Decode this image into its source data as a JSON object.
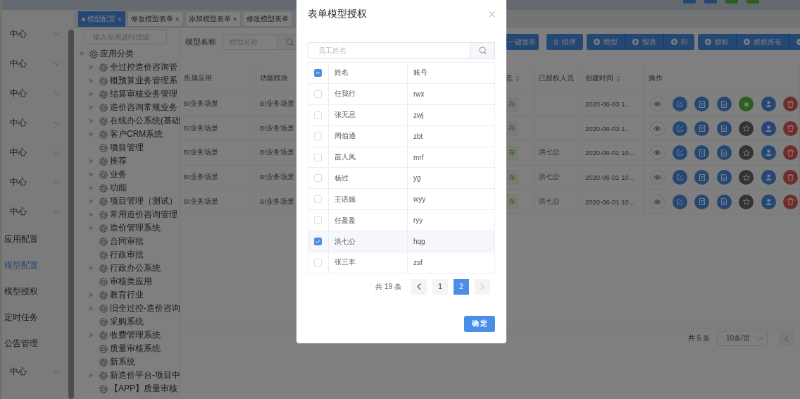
{
  "sidebar": {
    "groups": [
      {
        "label": "中心",
        "expanded": false
      },
      {
        "label": "中心",
        "expanded": false
      },
      {
        "label": "中心",
        "expanded": false
      },
      {
        "label": "中心",
        "expanded": false
      },
      {
        "label": "中心",
        "expanded": false
      },
      {
        "label": "中心",
        "expanded": false
      },
      {
        "label": "中心",
        "expanded": true,
        "children": [
          {
            "label": "应用配置",
            "selected": false
          },
          {
            "label": "模型配置",
            "selected": true
          },
          {
            "label": "模型授权",
            "selected": false
          },
          {
            "label": "定时任务",
            "selected": false
          },
          {
            "label": "公告管理",
            "selected": false
          }
        ]
      },
      {
        "label": "中心",
        "expanded": false
      }
    ]
  },
  "tabs": [
    {
      "label": "模型配置",
      "selected": true,
      "close": "×"
    },
    {
      "label": "修改模型表单",
      "selected": false,
      "close": "×"
    },
    {
      "label": "添加模型表单",
      "selected": false,
      "close": "×"
    },
    {
      "label": "修改模型表单",
      "selected": false
    }
  ],
  "tree": {
    "filter_placeholder": "输入应用进行过滤",
    "root": {
      "label": "应用分类",
      "kind": "branch",
      "expanded": true,
      "children": [
        {
          "label": "全过控造价咨询管",
          "kind": "branch"
        },
        {
          "label": "概预算业务管理系",
          "kind": "branch"
        },
        {
          "label": "结算审核业务管理",
          "kind": "branch"
        },
        {
          "label": "造价咨询常规业务",
          "kind": "branch"
        },
        {
          "label": "在线办公系统(基础",
          "kind": "branch"
        },
        {
          "label": "客户CRM系统",
          "kind": "branch"
        },
        {
          "label": "项目管理",
          "kind": "leaf"
        },
        {
          "label": "推荐",
          "kind": "branch"
        },
        {
          "label": "业务",
          "kind": "branch"
        },
        {
          "label": "功能",
          "kind": "branch"
        },
        {
          "label": "项目管理（测试）",
          "kind": "branch"
        },
        {
          "label": "常用造价咨询管理",
          "kind": "branch"
        },
        {
          "label": "造价管理系统",
          "kind": "branch"
        },
        {
          "label": "合同审批",
          "kind": "leaf"
        },
        {
          "label": "行政审批",
          "kind": "leaf"
        },
        {
          "label": "行政办公系统",
          "kind": "branch"
        },
        {
          "label": "审核类应用",
          "kind": "leaf"
        },
        {
          "label": "教育行业",
          "kind": "branch"
        },
        {
          "label": "旧全过控-造价咨询",
          "kind": "branch"
        },
        {
          "label": "采购系统",
          "kind": "leaf"
        },
        {
          "label": "收费管理系统",
          "kind": "branch"
        },
        {
          "label": "质量审核系统",
          "kind": "leaf"
        },
        {
          "label": "新系统",
          "kind": "leaf"
        },
        {
          "label": "新造价平台-项目中",
          "kind": "branch"
        },
        {
          "label": "【APP】质量审核",
          "kind": "leaf"
        }
      ]
    }
  },
  "toolbar": {
    "label": "模型名称",
    "search_placeholder": "模型名称",
    "button_groups": [
      [
        {
          "label": "一键发布",
          "kind": "plain"
        }
      ],
      [
        {
          "label": "排序",
          "kind": "sort"
        }
      ],
      [
        {
          "label": "模型",
          "kind": "add"
        },
        {
          "label": "报表",
          "kind": "add"
        },
        {
          "label": "BI",
          "kind": "add"
        }
      ],
      [
        {
          "label": "授权",
          "kind": "add"
        },
        {
          "label": "授权所有",
          "kind": "add"
        },
        {
          "kind": "remove"
        }
      ]
    ]
  },
  "table": {
    "columns": [
      {
        "label": "所属应用",
        "sortable": false
      },
      {
        "label": "功能模块",
        "sortable": false
      },
      {
        "label": "态",
        "sortable": true
      },
      {
        "label": "已授权人员",
        "sortable": false
      },
      {
        "label": "创建时间",
        "sortable": true
      },
      {
        "label": "操作",
        "sortable": false
      }
    ],
    "rows": [
      {
        "app": "BI业务场景",
        "module": "BI业务场景",
        "status": "布",
        "published": false,
        "created": "2020-06-03 1...",
        "starred": true
      },
      {
        "app": "BI业务场景",
        "module": "BI业务场景",
        "status": "布",
        "published": true,
        "created": "2020-06-03 1...",
        "starred": false
      },
      {
        "app": "BI业务场景",
        "module": "BI业务场景",
        "status": "布",
        "published": true,
        "authorized": "洪七公",
        "created": "2020-06-01 10...",
        "starred": false
      },
      {
        "app": "BI业务场景",
        "module": "BI业务场景",
        "status": "布",
        "published": true,
        "authorized": "洪七公",
        "created": "2020-06-01 10...",
        "starred": false
      },
      {
        "app": "BI业务场景",
        "module": "BI业务场景",
        "status": "布",
        "published": true,
        "authorized": "洪七公",
        "created": "2020-06-01 10...",
        "starred": false
      }
    ]
  },
  "pagination": {
    "total": "共 5 条",
    "page_size": "10条/页"
  },
  "modal": {
    "title": "表单模型授权",
    "search_placeholder": "员工姓名",
    "columns": [
      "姓名",
      "账号"
    ],
    "select_all_indeterminate": true,
    "rows": [
      {
        "name": "任我行",
        "account": "rwx",
        "checked": false
      },
      {
        "name": "张无忌",
        "account": "zwj",
        "checked": false
      },
      {
        "name": "周伯通",
        "account": "zbt",
        "checked": false
      },
      {
        "name": "苗人凤",
        "account": "mrf",
        "checked": false
      },
      {
        "name": "杨过",
        "account": "yg",
        "checked": false
      },
      {
        "name": "王语嫣",
        "account": "wyy",
        "checked": false
      },
      {
        "name": "任盈盈",
        "account": "ryy",
        "checked": false
      },
      {
        "name": "洪七公",
        "account": "hqg",
        "checked": true
      },
      {
        "name": "张三丰",
        "account": "zsf",
        "checked": false
      }
    ],
    "total": "共 19 条",
    "prev_disabled": false,
    "next_disabled": true,
    "pages": [
      {
        "label": "1",
        "selected": false
      },
      {
        "label": "2",
        "selected": true
      }
    ],
    "confirm": "确 定"
  }
}
